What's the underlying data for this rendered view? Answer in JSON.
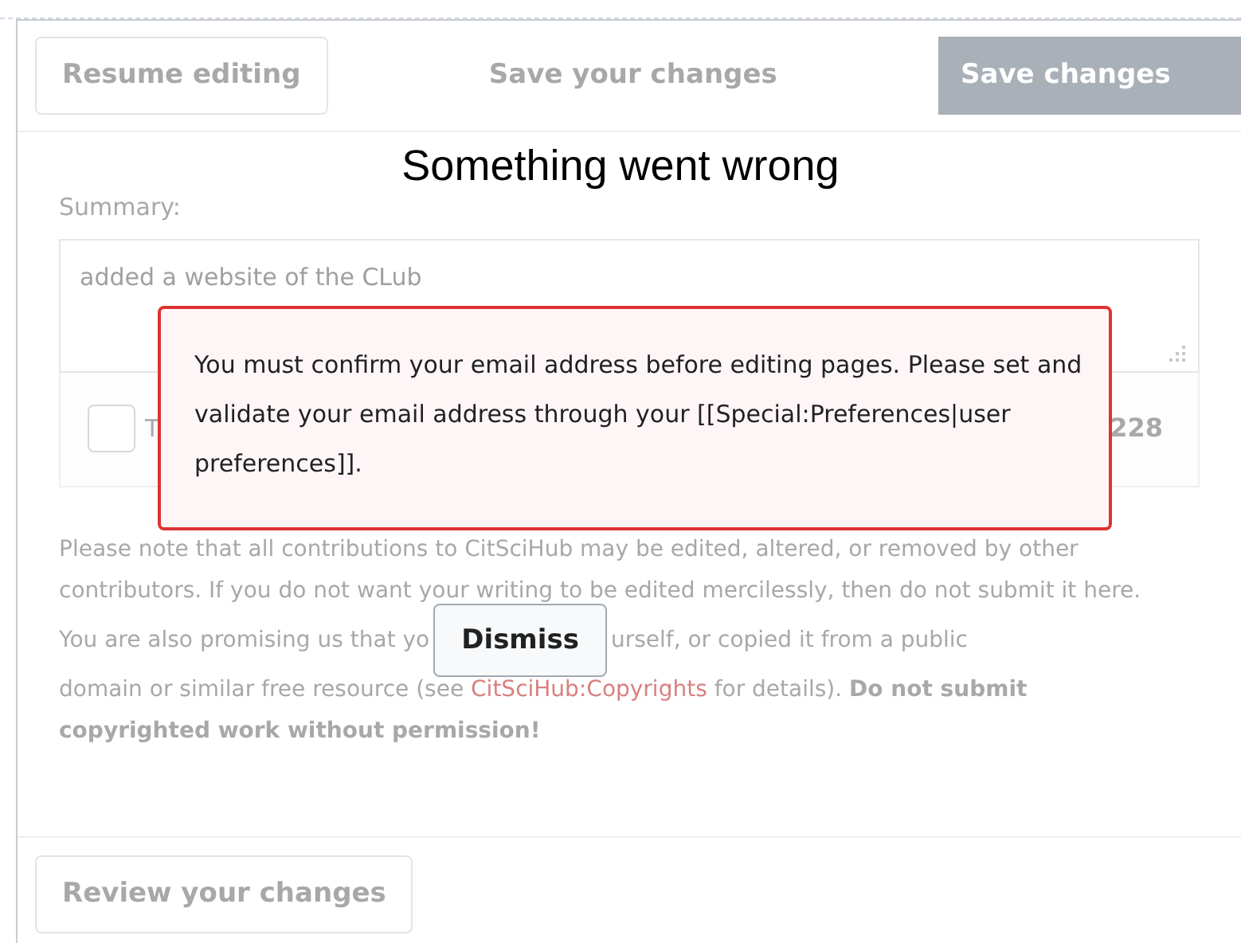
{
  "dialog": {
    "header": {
      "resume_button": "Resume editing",
      "title": "Save your changes",
      "save_button": "Save changes"
    },
    "summary": {
      "label": "Summary:",
      "value": "added a website of the CLub"
    },
    "options": {
      "checkbox": {
        "label": "T",
        "checked": false
      },
      "counter": "228"
    },
    "notice": {
      "paragraph": "Please note that all contributions to CitSciHub may be edited, altered, or removed by other contributors. If you do not want your writing to be edited mercilessly, then do not submit it here.",
      "line_start": "You are also promising us that yo",
      "line_end": "urself, or copied it from a public",
      "rest": "domain or similar free resource (see ",
      "link": "CitSciHub:Copyrights",
      "after_link": " for details). ",
      "warning": "Do not submit copyrighted work without permission!"
    },
    "review_button": "Review your changes"
  },
  "error": {
    "title": "Something went wrong",
    "message": "You must confirm your email address before editing pages. Please set and validate your email address through your [[Special:Preferences|user preferences]].",
    "dismiss_button": "Dismiss"
  }
}
